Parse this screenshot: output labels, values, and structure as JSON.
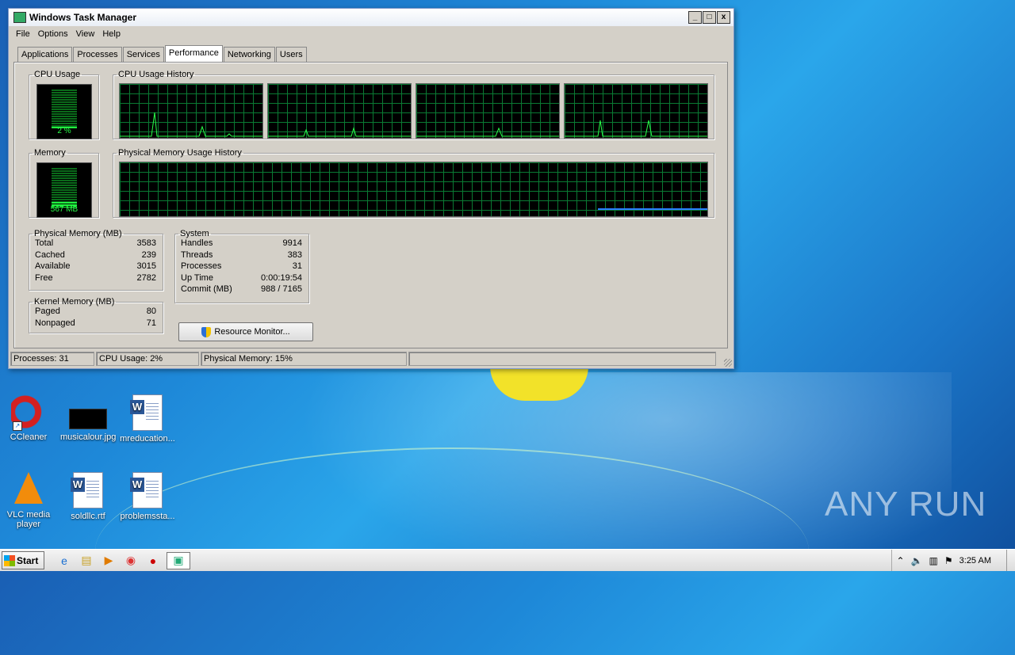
{
  "window": {
    "title": "Windows Task Manager",
    "buttons": [
      "_",
      "□",
      "x"
    ]
  },
  "menu": [
    "File",
    "Options",
    "View",
    "Help"
  ],
  "tabs": [
    "Applications",
    "Processes",
    "Services",
    "Performance",
    "Networking",
    "Users"
  ],
  "active_tab": "Performance",
  "cpu": {
    "label": "CPU Usage",
    "value": "2 %",
    "history_label": "CPU Usage History",
    "level": 0.02
  },
  "memory": {
    "label": "Memory",
    "value": "567 MB",
    "history_label": "Physical Memory Usage History",
    "level": 0.15
  },
  "physical_memory": {
    "label": "Physical Memory (MB)",
    "rows": [
      {
        "k": "Total",
        "v": "3583"
      },
      {
        "k": "Cached",
        "v": "239"
      },
      {
        "k": "Available",
        "v": "3015"
      },
      {
        "k": "Free",
        "v": "2782"
      }
    ]
  },
  "kernel_memory": {
    "label": "Kernel Memory (MB)",
    "rows": [
      {
        "k": "Paged",
        "v": "80"
      },
      {
        "k": "Nonpaged",
        "v": "71"
      }
    ]
  },
  "system": {
    "label": "System",
    "rows": [
      {
        "k": "Handles",
        "v": "9914"
      },
      {
        "k": "Threads",
        "v": "383"
      },
      {
        "k": "Processes",
        "v": "31"
      },
      {
        "k": "Up Time",
        "v": "0:00:19:54"
      },
      {
        "k": "Commit (MB)",
        "v": "988 / 7165"
      }
    ]
  },
  "resource_monitor_button": "Resource Monitor...",
  "statusbar": {
    "processes": "Processes: 31",
    "cpu": "CPU Usage: 2%",
    "memory": "Physical Memory: 15%"
  },
  "desktop_icons": [
    "CCleaner",
    "musicalour.jpg",
    "mreducation...",
    "VLC media player",
    "soldllc.rtf",
    "problemssta..."
  ],
  "watermark": "ANY RUN",
  "taskbar": {
    "start": "Start",
    "clock": "3:25 AM"
  },
  "colors": {
    "graph_bg": "#000000",
    "graph_grid": "#0a7a33",
    "graph_line": "#2aff4a",
    "memory_line": "#2a7fff",
    "window_bg": "#d4d0c8"
  }
}
